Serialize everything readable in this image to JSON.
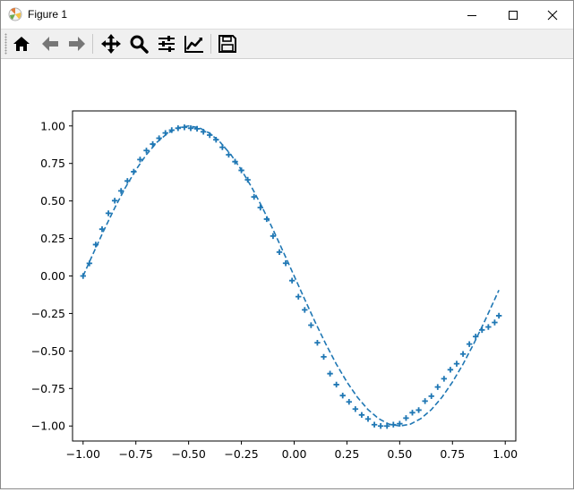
{
  "window": {
    "title": "Figure 1",
    "controls": {
      "minimize": "minimize-icon",
      "maximize": "maximize-icon",
      "close": "close-icon"
    }
  },
  "toolbar": {
    "buttons": [
      {
        "name": "home",
        "icon": "home-icon"
      },
      {
        "name": "back",
        "icon": "arrow-left-icon"
      },
      {
        "name": "forward",
        "icon": "arrow-right-icon"
      },
      {
        "name": "pan",
        "icon": "move-icon"
      },
      {
        "name": "zoom",
        "icon": "magnifier-icon"
      },
      {
        "name": "configure-subplots",
        "icon": "sliders-icon"
      },
      {
        "name": "edit-axis",
        "icon": "line-chart-icon"
      },
      {
        "name": "save",
        "icon": "floppy-disk-icon"
      }
    ]
  },
  "chart_data": {
    "type": "line",
    "title": "",
    "xlabel": "",
    "ylabel": "",
    "xlim": [
      -1.05,
      1.05
    ],
    "ylim": [
      -1.1,
      1.1
    ],
    "xticks": [
      -1.0,
      -0.75,
      -0.5,
      -0.25,
      0.0,
      0.25,
      0.5,
      0.75,
      1.0
    ],
    "xtick_labels": [
      "−1.00",
      "−0.75",
      "−0.50",
      "−0.25",
      "0.00",
      "0.25",
      "0.50",
      "0.75",
      "1.00"
    ],
    "yticks": [
      -1.0,
      -0.75,
      -0.5,
      -0.25,
      0.0,
      0.25,
      0.5,
      0.75,
      1.0
    ],
    "ytick_labels": [
      "−1.00",
      "−0.75",
      "−0.50",
      "−0.25",
      "0.00",
      "0.25",
      "0.50",
      "0.75",
      "1.00"
    ],
    "grid": false,
    "legend": "none",
    "series": [
      {
        "style": "dashed-line",
        "color": "#1f77b4",
        "x": [
          -1.0,
          -0.95,
          -0.9,
          -0.85,
          -0.8,
          -0.75,
          -0.7,
          -0.65,
          -0.6,
          -0.55,
          -0.5,
          -0.45,
          -0.4,
          -0.35,
          -0.3,
          -0.25,
          -0.2,
          -0.15,
          -0.1,
          -0.05,
          0.0,
          0.05,
          0.1,
          0.15,
          0.2,
          0.25,
          0.3,
          0.35,
          0.4,
          0.45,
          0.5,
          0.55,
          0.6,
          0.65,
          0.7,
          0.75,
          0.8,
          0.85,
          0.9,
          0.95,
          0.97
        ],
        "y": [
          0.0,
          0.156,
          0.309,
          0.454,
          0.588,
          0.707,
          0.809,
          0.891,
          0.951,
          0.988,
          1.0,
          0.988,
          0.951,
          0.891,
          0.809,
          0.707,
          0.588,
          0.454,
          0.309,
          0.156,
          0.0,
          -0.156,
          -0.309,
          -0.454,
          -0.588,
          -0.707,
          -0.809,
          -0.891,
          -0.951,
          -0.988,
          -1.0,
          -0.988,
          -0.951,
          -0.891,
          -0.809,
          -0.707,
          -0.588,
          -0.454,
          -0.309,
          -0.156,
          -0.094
        ]
      },
      {
        "style": "plus-markers",
        "color": "#1f77b4",
        "x": [
          -1.0,
          -0.97,
          -0.94,
          -0.91,
          -0.88,
          -0.85,
          -0.82,
          -0.79,
          -0.76,
          -0.73,
          -0.7,
          -0.67,
          -0.64,
          -0.61,
          -0.58,
          -0.55,
          -0.52,
          -0.49,
          -0.46,
          -0.43,
          -0.4,
          -0.37,
          -0.34,
          -0.31,
          -0.28,
          -0.25,
          -0.22,
          -0.19,
          -0.16,
          -0.13,
          -0.1,
          -0.07,
          -0.04,
          -0.01,
          0.02,
          0.05,
          0.08,
          0.11,
          0.14,
          0.17,
          0.2,
          0.23,
          0.26,
          0.29,
          0.32,
          0.35,
          0.38,
          0.41,
          0.44,
          0.47,
          0.5,
          0.53,
          0.56,
          0.59,
          0.62,
          0.65,
          0.68,
          0.71,
          0.74,
          0.77,
          0.8,
          0.83,
          0.86,
          0.89,
          0.92,
          0.95,
          0.97
        ],
        "y": [
          0.0,
          0.084,
          0.209,
          0.312,
          0.418,
          0.502,
          0.567,
          0.633,
          0.695,
          0.776,
          0.836,
          0.879,
          0.918,
          0.953,
          0.972,
          0.985,
          0.991,
          0.985,
          0.981,
          0.961,
          0.939,
          0.908,
          0.858,
          0.808,
          0.762,
          0.704,
          0.641,
          0.527,
          0.456,
          0.379,
          0.266,
          0.159,
          0.085,
          -0.031,
          -0.138,
          -0.226,
          -0.328,
          -0.445,
          -0.539,
          -0.651,
          -0.724,
          -0.797,
          -0.839,
          -0.887,
          -0.926,
          -0.953,
          -0.991,
          -1.0,
          -1.0,
          -0.991,
          -0.985,
          -0.947,
          -0.911,
          -0.894,
          -0.834,
          -0.801,
          -0.74,
          -0.685,
          -0.625,
          -0.585,
          -0.52,
          -0.454,
          -0.404,
          -0.36,
          -0.34,
          -0.31,
          -0.265
        ]
      }
    ]
  }
}
